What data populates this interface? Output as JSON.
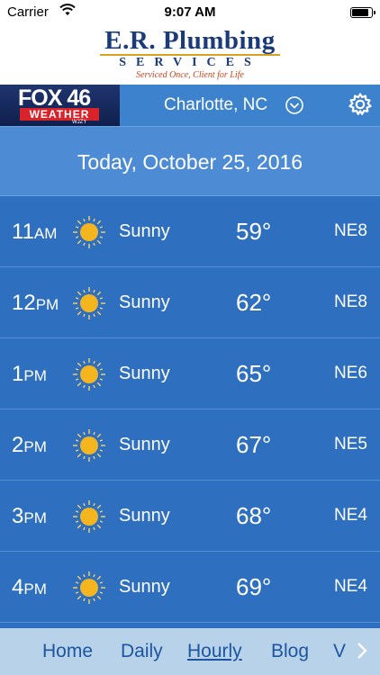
{
  "status_bar": {
    "carrier": "Carrier",
    "time": "9:07 AM",
    "battery_level": 0.9
  },
  "banner": {
    "brand_line1": "E.R. Plumbing",
    "brand_line2": "SERVICES",
    "tagline": "Serviced Once, Client for Life"
  },
  "header": {
    "logo_text_top": "FOX 46",
    "logo_text_bottom": "WEATHER",
    "logo_callsign": "WJZY",
    "location": "Charlotte, NC"
  },
  "date_label": "Today, October 25, 2016",
  "forecast": [
    {
      "hour": "11",
      "ampm": "AM",
      "condition": "Sunny",
      "temp": "59°",
      "wind": "NE8"
    },
    {
      "hour": "12",
      "ampm": "PM",
      "condition": "Sunny",
      "temp": "62°",
      "wind": "NE8"
    },
    {
      "hour": "1",
      "ampm": "PM",
      "condition": "Sunny",
      "temp": "65°",
      "wind": "NE6"
    },
    {
      "hour": "2",
      "ampm": "PM",
      "condition": "Sunny",
      "temp": "67°",
      "wind": "NE5"
    },
    {
      "hour": "3",
      "ampm": "PM",
      "condition": "Sunny",
      "temp": "68°",
      "wind": "NE4"
    },
    {
      "hour": "4",
      "ampm": "PM",
      "condition": "Sunny",
      "temp": "69°",
      "wind": "NE4"
    }
  ],
  "nav": {
    "items": [
      "Home",
      "Daily",
      "Hourly",
      "Blog",
      "V"
    ],
    "active": "Hourly"
  },
  "colors": {
    "background": "#2f6fbf",
    "header": "#3d82cc",
    "nav": "#b8d2ea",
    "nav_text": "#1c56a0",
    "sun": "#f5b51e"
  }
}
